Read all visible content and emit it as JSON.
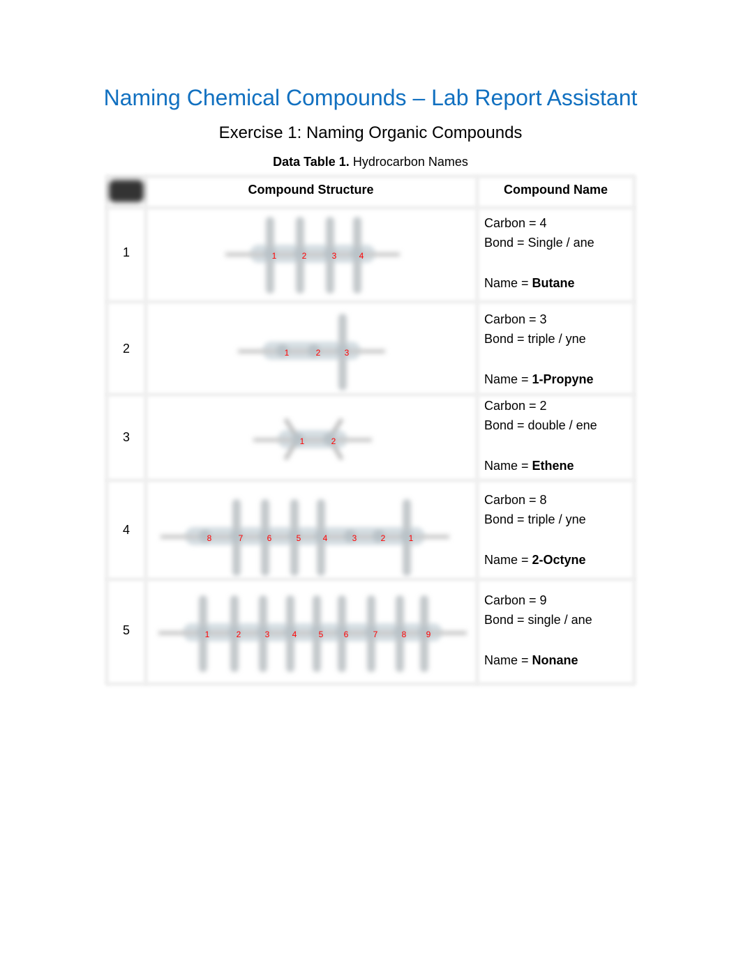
{
  "title": "Naming Chemical Compounds – Lab Report Assistant",
  "subtitle": "Exercise 1: Naming Organic Compounds",
  "caption": {
    "bold": "Data Table 1.",
    "text": "Hydrocarbon Names"
  },
  "table": {
    "headers": [
      "Compound Structure",
      "Compound Name"
    ],
    "rows": [
      {
        "num": "1",
        "carbon": "Carbon = 4",
        "bond": "Bond = Single / ane",
        "name_prefix": "Name = ",
        "name": "Butane",
        "labels": [
          "1",
          "2",
          "3",
          "4"
        ]
      },
      {
        "num": "2",
        "carbon": "Carbon = 3",
        "bond": "Bond = triple / yne",
        "name_prefix": "Name = ",
        "name": "1-Propyne",
        "labels": [
          "1",
          "2",
          "3"
        ]
      },
      {
        "num": "3",
        "carbon": "Carbon = 2",
        "bond": "Bond = double / ene",
        "name_prefix": "Name = ",
        "name": "Ethene",
        "labels": [
          "1",
          "2"
        ]
      },
      {
        "num": "4",
        "carbon": "Carbon = 8",
        "bond": "Bond = triple / yne",
        "name_prefix": "Name = ",
        "name": "2-Octyne",
        "labels": [
          "8",
          "7",
          "6",
          "5",
          "4",
          "3",
          "2",
          "1"
        ]
      },
      {
        "num": "5",
        "carbon": "Carbon = 9",
        "bond": "Bond = single / ane",
        "name_prefix": "Name = ",
        "name": "Nonane",
        "labels": [
          "1",
          "2",
          "3",
          "4",
          "5",
          "6",
          "7",
          "8",
          "9"
        ]
      }
    ]
  },
  "colors": {
    "title": "#1170c0",
    "carbon_label": "#ff0000"
  }
}
